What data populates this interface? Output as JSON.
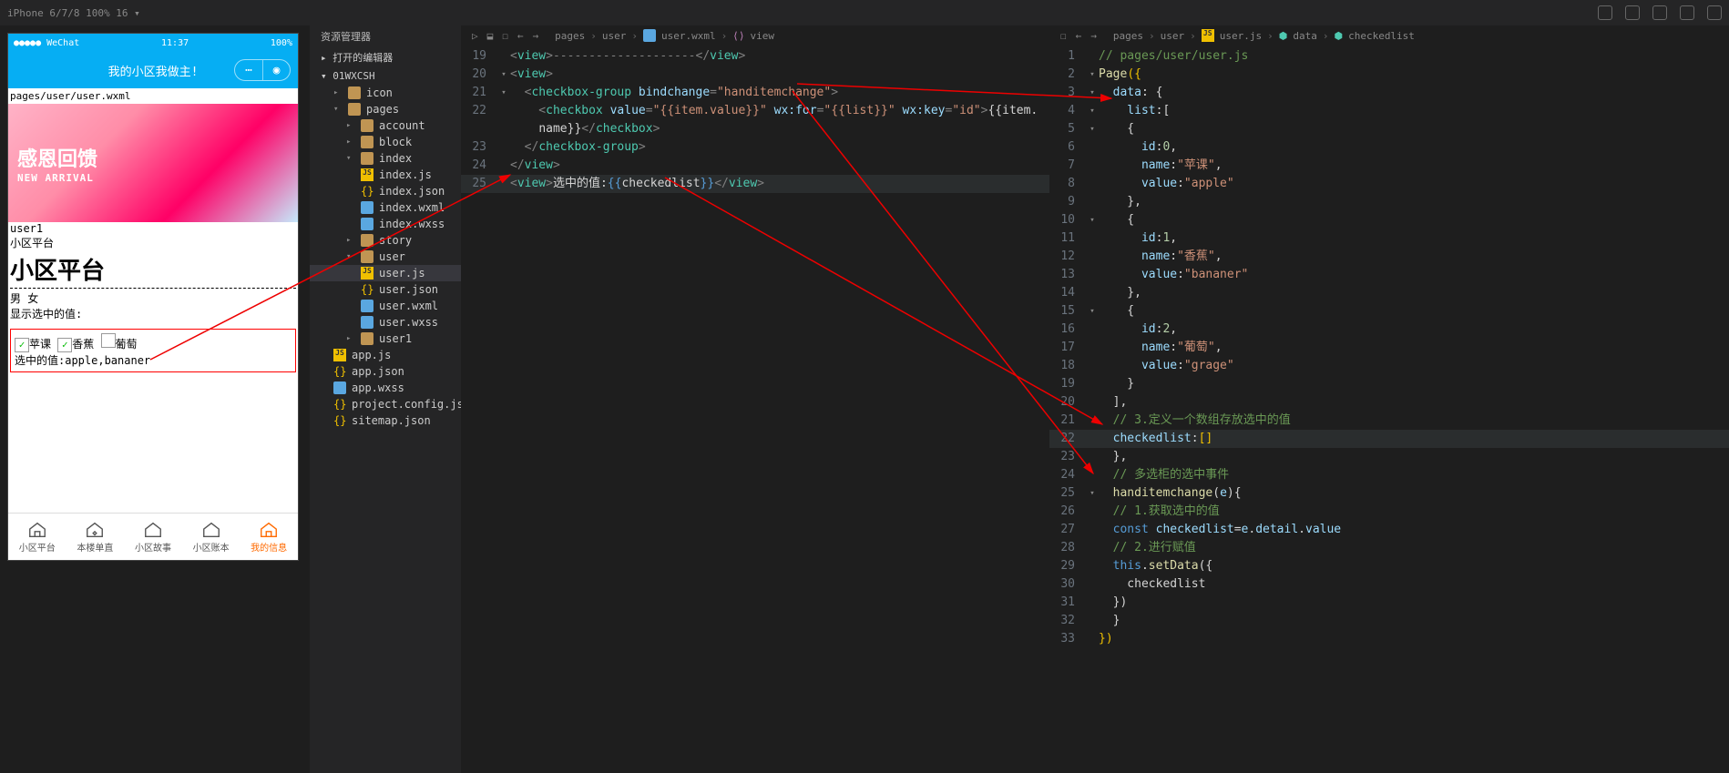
{
  "device_selector": "iPhone 6/7/8 100% 16 ▾",
  "simulator": {
    "carrier": "●●●●● WeChat",
    "time": "11:37",
    "battery": "100%",
    "nav_title": "我的小区我做主!",
    "page_path": "pages/user/user.wxml",
    "banner_line1": "感恩回馈",
    "banner_line2": "NEW ARRIVAL",
    "user_label": "user1",
    "platform_small": "小区平台",
    "platform_h2": "小区平台",
    "gender_male": "男",
    "gender_female": "女",
    "show_selected_label": "显示选中的值:",
    "cb1": "苹课",
    "cb2": "香蕉",
    "cb3": "葡萄",
    "selected_text": "选中的值:apple,bananer",
    "tabs": [
      "小区平台",
      "本楼单直",
      "小区故事",
      "小区账本",
      "我的信息"
    ]
  },
  "explorer": {
    "title": "资源管理器",
    "opened": "打开的编辑器",
    "root": "01WXCSH",
    "items": {
      "icon": "icon",
      "pages": "pages",
      "account": "account",
      "block": "block",
      "index": "index",
      "index_js": "index.js",
      "index_json": "index.json",
      "index_wxml": "index.wxml",
      "index_wxss": "index.wxss",
      "story": "story",
      "user": "user",
      "user_js": "user.js",
      "user_json": "user.json",
      "user_wxml": "user.wxml",
      "user_wxss": "user.wxss",
      "user1": "user1",
      "app_js": "app.js",
      "app_json": "app.json",
      "app_wxss": "app.wxss",
      "project_config": "project.config.json",
      "sitemap": "sitemap.json"
    }
  },
  "editor1": {
    "tab_name": "user.wxml",
    "breadcrumb": [
      "pages",
      "user",
      "user.wxml",
      "view"
    ],
    "lines": {
      "l19_a": "<",
      "l19_b": "view",
      "l19_c": ">--------------------</",
      "l19_d": "view",
      "l19_e": ">",
      "l20_a": "<",
      "l20_b": "view",
      "l20_c": ">",
      "l21_a": "  <",
      "l21_b": "checkbox-group",
      "l21_c": " bindchange",
      "l21_d": "=",
      "l21_e": "\"handitemchange\"",
      "l21_f": ">",
      "l22_a": "    <",
      "l22_b": "checkbox",
      "l22_c": " value",
      "l22_d": "=",
      "l22_e": "\"{{item.value}}\"",
      "l22_f": " wx:for",
      "l22_g": "=",
      "l22_h": "\"{{list}}\"",
      "l22_i": " wx:key",
      "l22_j": "=",
      "l22_k": "\"id\"",
      "l22_l": ">",
      "l22_m": "{{item.",
      "l22b_a": "name}}",
      "l22b_b": "</",
      "l22b_c": "checkbox",
      "l22b_d": ">",
      "l23_a": "  </",
      "l23_b": "checkbox-group",
      "l23_c": ">",
      "l24_a": "</",
      "l24_b": "view",
      "l24_c": ">",
      "l25_a": "<",
      "l25_b": "view",
      "l25_c": ">",
      "l25_d": "选中的值:",
      "l25_e": "{{",
      "l25_f": "checkedlist",
      "l25_g": "}}",
      "l25_h": "</",
      "l25_i": "view",
      "l25_j": ">"
    }
  },
  "editor2": {
    "tab_name": "user.js",
    "breadcrumb": [
      "pages",
      "user",
      "user.js",
      "data",
      "checkedlist"
    ],
    "lines": {
      "l1": "// pages/user/user.js",
      "l2_a": "Page",
      "l2_b": "({",
      "l3_a": "  data",
      "l3_b": ": {",
      "l4_a": "    list",
      "l4_b": ":[",
      "l5": "    {",
      "l6_a": "      id",
      "l6_b": ":",
      "l6_c": "0",
      "l6_d": ",",
      "l7_a": "      name",
      "l7_b": ":",
      "l7_c": "\"苹课\"",
      "l7_d": ",",
      "l8_a": "      value",
      "l8_b": ":",
      "l8_c": "\"apple\"",
      "l9": "    },",
      "l10": "    {",
      "l11_a": "      id",
      "l11_b": ":",
      "l11_c": "1",
      "l11_d": ",",
      "l12_a": "      name",
      "l12_b": ":",
      "l12_c": "\"香蕉\"",
      "l12_d": ",",
      "l13_a": "      value",
      "l13_b": ":",
      "l13_c": "\"bananer\"",
      "l14": "    },",
      "l15": "    {",
      "l16_a": "      id",
      "l16_b": ":",
      "l16_c": "2",
      "l16_d": ",",
      "l17_a": "      name",
      "l17_b": ":",
      "l17_c": "\"葡萄\"",
      "l17_d": ",",
      "l18_a": "      value",
      "l18_b": ":",
      "l18_c": "\"grage\"",
      "l19": "    }",
      "l20": "  ],",
      "l21": "  // 3.定义一个数组存放选中的值",
      "l22_a": "  checkedlist",
      "l22_b": ":",
      "l22_c": "[]",
      "l23": "  },",
      "l24": "  // 多选柜的选中事件",
      "l25_a": "  handitemchange",
      "l25_b": "(",
      "l25_c": "e",
      "l25_d": "){",
      "l26": "  // 1.获取选中的值",
      "l27_a": "  const",
      "l27_b": " checkedlist",
      "l27_c": "=",
      "l27_d": "e",
      "l27_e": ".",
      "l27_f": "detail",
      "l27_g": ".",
      "l27_h": "value",
      "l28": "  // 2.进行赋值",
      "l29_a": "  this",
      "l29_b": ".",
      "l29_c": "setData",
      "l29_d": "({",
      "l30": "    checkedlist",
      "l31": "  })",
      "l32": "  }",
      "l33": "})"
    }
  }
}
